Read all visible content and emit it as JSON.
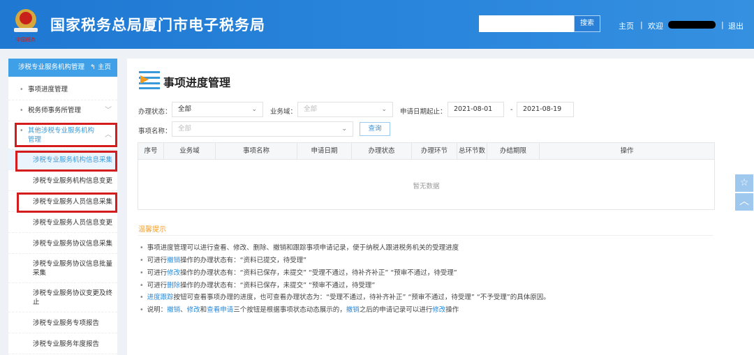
{
  "header": {
    "title": "国家税务总局厦门市电子税务局",
    "logo_text": "中国税务",
    "search_placeholder": "",
    "search_label": "搜索",
    "home": "主页",
    "sep": "|",
    "welcome": "欢迎",
    "logout": "退出"
  },
  "sidebar": {
    "title": "涉税专业服务机构管理",
    "home": "主页",
    "items": [
      {
        "label": "事项进度管理"
      },
      {
        "label": "税务师事务所管理"
      },
      {
        "label": "其他涉税专业服务机构管理"
      },
      {
        "label": "涉税专业服务机构信息采集"
      },
      {
        "label": "涉税专业服务机构信息变更"
      },
      {
        "label": "涉税专业服务人员信息采集"
      },
      {
        "label": "涉税专业服务人员信息变更"
      },
      {
        "label": "涉税专业服务协议信息采集"
      },
      {
        "label": "涉税专业服务协议信息批量采集"
      },
      {
        "label": "涉税专业服务协议变更及终止"
      },
      {
        "label": "涉税专业服务专项报告"
      },
      {
        "label": "涉税专业服务年度报告"
      }
    ]
  },
  "main": {
    "title": "事项进度管理",
    "filters": {
      "status_label": "办理状态：",
      "status_value": "全部",
      "domain_label": "业务域：",
      "domain_placeholder": "全部",
      "date_label": "申请日期起止：",
      "date_from": "2021-08-01",
      "date_sep": "-",
      "date_to": "2021-08-19",
      "item_label": "事项名称：",
      "item_placeholder": "全部",
      "query": "查询"
    },
    "columns": [
      "序号",
      "业务域",
      "事项名称",
      "申请日期",
      "办理状态",
      "办理环节",
      "总环节数",
      "办结期限",
      "操作"
    ],
    "empty": "暂无数据",
    "tips_title": "温馨提示",
    "tips": {
      "t1": "事项进度管理可以进行查看、修改、删除、撤销和跟踪事项申请记录，便于纳税人跟进税务机关的受理进度",
      "t2a": "可进行",
      "t2b": "撤销",
      "t2c": "操作的办理状态有：“资料已提交，待受理”",
      "t3a": "可进行",
      "t3b": "修改",
      "t3c": "操作的办理状态有：“资料已保存，未提交”  “受理不通过，待补齐补正”  “预审不通过，待受理”",
      "t4a": "可进行",
      "t4b": "删除",
      "t4c": "操作的办理状态有：“资料已保存，未提交”  “预审不通过，待受理”",
      "t5a": "进度跟踪",
      "t5b": "按钮可查看事项办理的进度，也可查看办理状态为：“受理不通过，待补齐补正”  “预审不通过，待受理”  “不予受理”的具体原因。",
      "t6a": "说明：",
      "t6b": "撤销",
      "t6c": "、",
      "t6d": "修改",
      "t6e": "和",
      "t6f": "查看申请",
      "t6g": "三个按钮是根据事项状态动态展示的，",
      "t6h": "撤销",
      "t6i": "之后的申请记录可以进行",
      "t6j": "修改",
      "t6k": "操作"
    }
  },
  "float": {
    "star": "☆",
    "up": "︿"
  }
}
